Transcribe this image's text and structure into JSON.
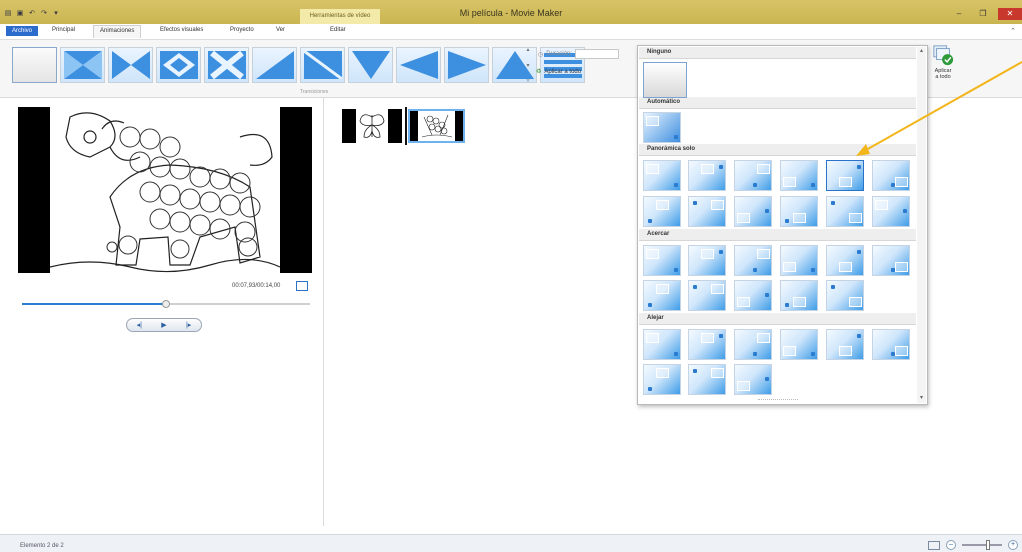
{
  "window": {
    "title": "Mi película - Movie Maker",
    "contextual_group": "Herramientas de vídeo",
    "minimize": "–",
    "maximize": "❐",
    "close": "✕"
  },
  "quick_access": {
    "save": "▣",
    "undo": "↶",
    "redo": "↷",
    "customize": "▾"
  },
  "tabs": {
    "file": "Archivo",
    "home": "Principal",
    "animations": "Animaciones",
    "visual_effects": "Efectos visuales",
    "project": "Proyecto",
    "view": "Ver",
    "edit": "Editar",
    "active": "Animaciones"
  },
  "ribbon": {
    "transitions_label": "Transiciones",
    "duration_label": "Duración:",
    "duration_value": "",
    "apply_all_label": "Aplicar a todo",
    "panzoom_apply_all_label_1": "Aplicar",
    "panzoom_apply_all_label_2": "a todo",
    "collapse": "⌃"
  },
  "panzoom_gallery": {
    "sections": [
      {
        "key": "none",
        "label": "Ninguno",
        "count": 1
      },
      {
        "key": "auto",
        "label": "Automático",
        "count": 1
      },
      {
        "key": "pan",
        "label": "Panorámica solo",
        "count": 12,
        "selected_index": 4
      },
      {
        "key": "zoom_in",
        "label": "Acercar",
        "count": 11
      },
      {
        "key": "zoom_out",
        "label": "Alejar",
        "count": 9
      }
    ]
  },
  "preview": {
    "time": "00:07,93/00:14,00",
    "seek_progress": 0.5,
    "controls": {
      "prev_frame": "◂|",
      "play": "▶",
      "next_frame": "|▸"
    }
  },
  "status": {
    "text": "Elemento 2 de 2",
    "zoom_out": "–",
    "zoom_in": "+",
    "zoom_level": 0.65
  },
  "colors": {
    "accent": "#2b6bcc",
    "title_bar": "#d1bd5a",
    "arrow": "#f2b51a"
  }
}
